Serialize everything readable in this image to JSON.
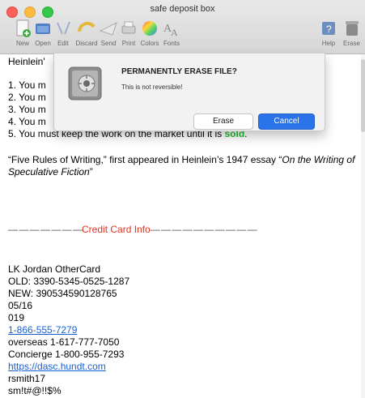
{
  "window": {
    "title": "safe deposit box"
  },
  "toolbar": {
    "items": [
      {
        "label": "New",
        "icon": "new-icon"
      },
      {
        "label": "Open",
        "icon": "open-icon"
      },
      {
        "label": "Edit",
        "icon": "edit-icon"
      },
      {
        "label": "Discard",
        "icon": "discard-icon"
      },
      {
        "label": "Send",
        "icon": "send-icon"
      },
      {
        "label": "Print",
        "icon": "print-icon"
      },
      {
        "label": "Colors",
        "icon": "colors-icon"
      },
      {
        "label": "Fonts",
        "icon": "fonts-icon"
      },
      {
        "label": "Help",
        "icon": "help-icon"
      },
      {
        "label": "Erase",
        "icon": "erase-icon"
      }
    ]
  },
  "dialog": {
    "title": "PERMANENTLY ERASE FILE?",
    "message": "This is not reversible!",
    "erase_label": "Erase",
    "cancel_label": "Cancel",
    "icon": "safe-icon"
  },
  "document": {
    "heading_fragment": "Heinlein'",
    "rules": [
      "1. You m",
      "2. You m",
      "3. You m",
      "4. You m"
    ],
    "rule5_prefix": "5. You must keep the work on the market until it is ",
    "rule5_highlight": "sold",
    "rule5_suffix": ".",
    "quote_prefix": "“Five Rules of Writing,” first appeared in Heinlein’s 1947 essay “",
    "quote_title": "On the Writing of Speculative Fiction",
    "quote_suffix": "”",
    "credit_dashes_left": "— — — — — — —",
    "credit_label": "Credit Card Info",
    "credit_dashes_right": "— — — — — — — — — —",
    "card_lines": [
      "LK Jordan  OtherCard",
      "OLD: 3390-5345-0525-1287",
      "NEW: 390534590128765",
      "05/16",
      "019"
    ],
    "phone_link": "1-866-555-7279",
    "contact_lines": [
      "overseas 1-617-777-7050",
      "Concierge 1-800-955-7293"
    ],
    "web_link": "https://dasc.hundt.com",
    "username": "rsmith17",
    "password_fragment": "sm!t#@!!$%"
  },
  "colors": {
    "accent_blue": "#2b73e8",
    "highlight_green": "#1fbf2c",
    "heading_red": "#e0321f"
  }
}
